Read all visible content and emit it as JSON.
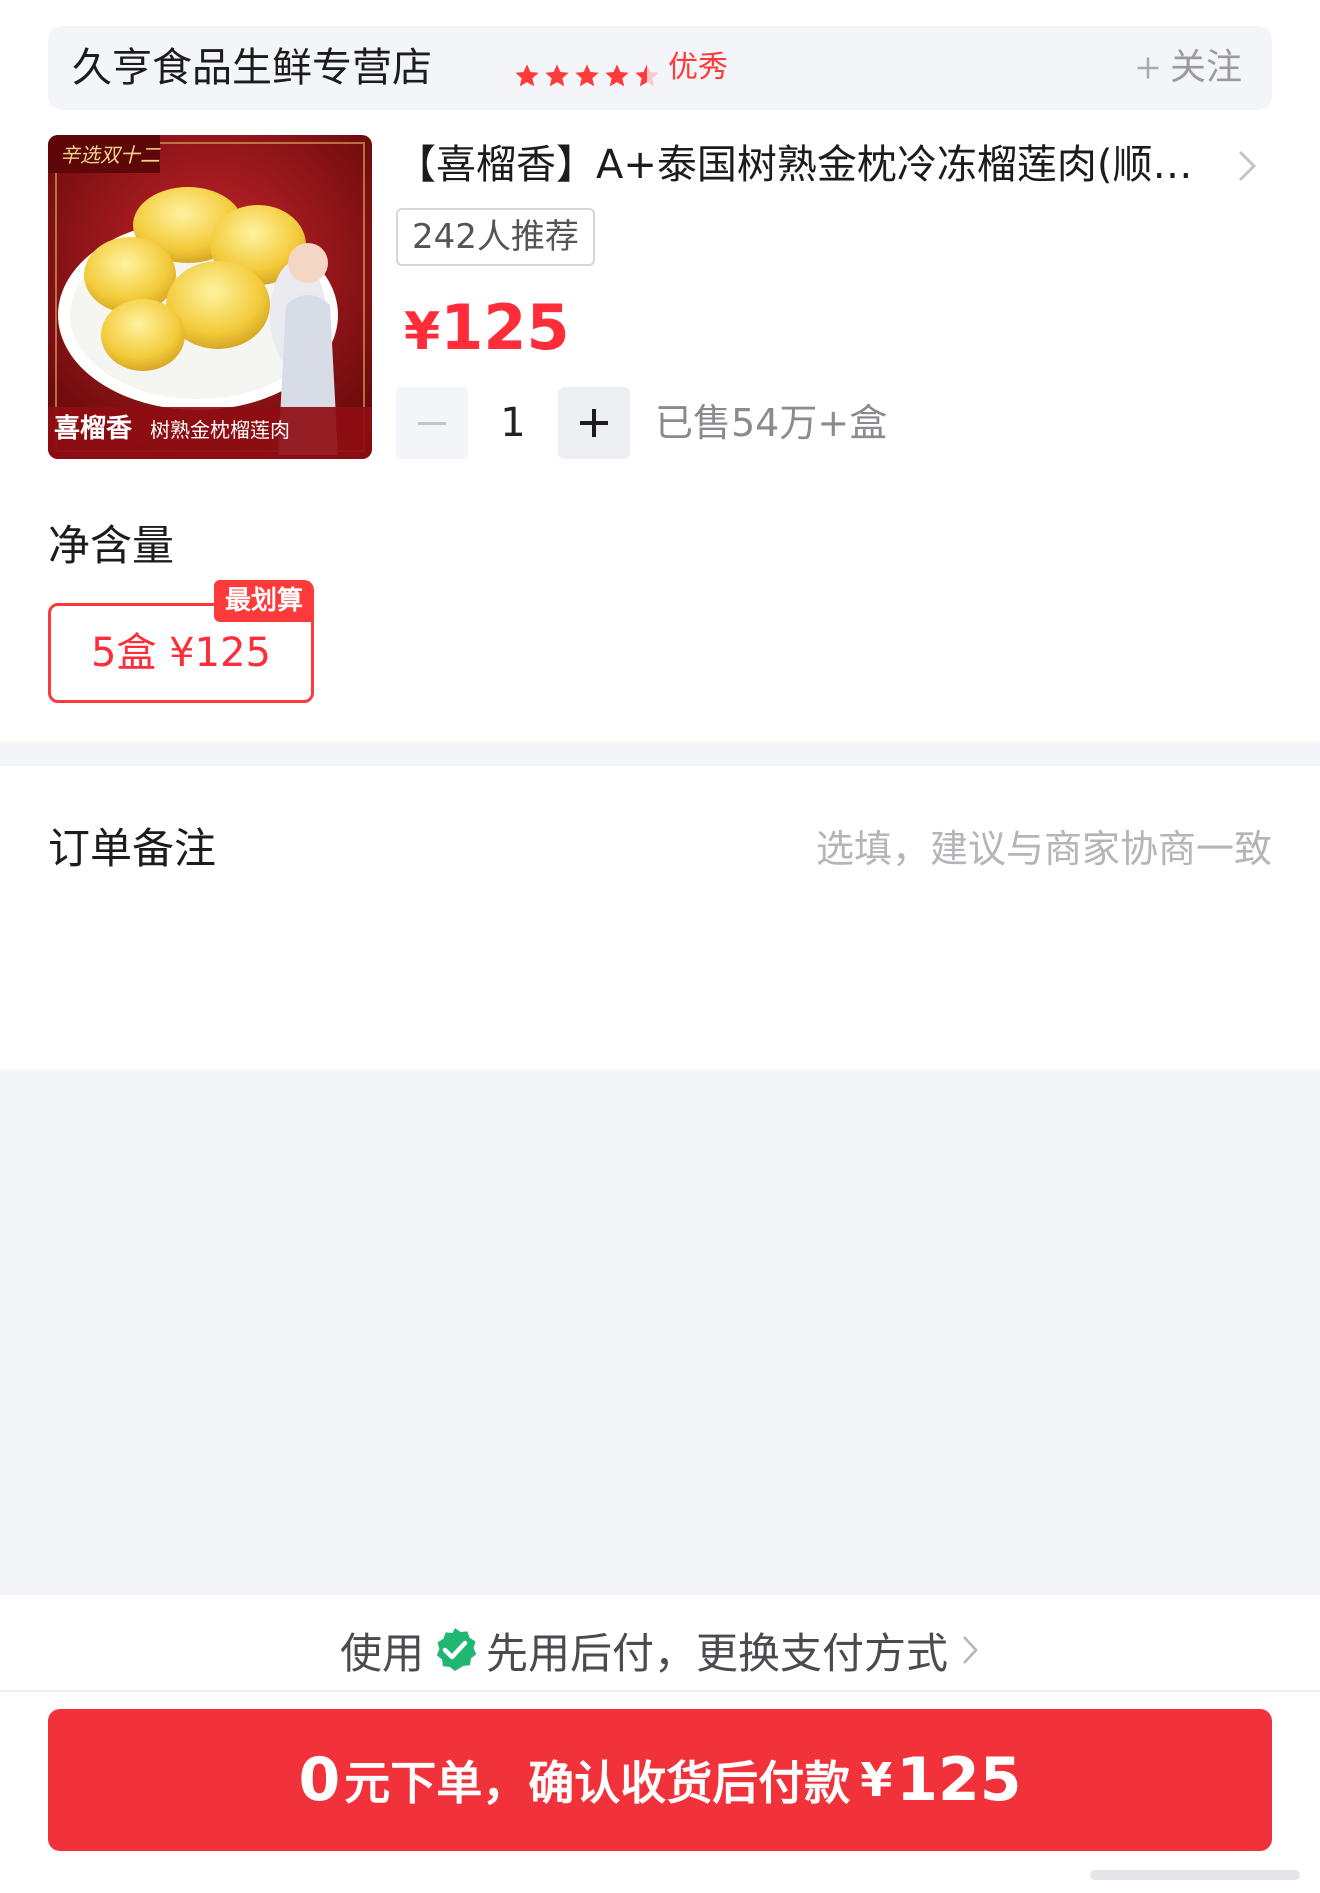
{
  "store": {
    "name": "久亨食品生鲜专营店",
    "rating_stars": 4.5,
    "rating_label": "优秀",
    "follow_label": "关注",
    "follow_icon": "plus-icon"
  },
  "product": {
    "image_banner": "辛选双十二",
    "image_brand": "喜榴香",
    "image_caption": "树熟金枕榴莲肉",
    "title": "【喜榴香】A+泰国树熟金枕冷冻榴莲肉(顺丰冷链)",
    "recommend_tag": "242人推荐",
    "price_symbol": "¥",
    "price_value": "125",
    "quantity": "1",
    "sold": "已售54万+盒"
  },
  "spec": {
    "title": "净含量",
    "option_label": "5盒 ¥125",
    "option_badge": "最划算"
  },
  "remark": {
    "label": "订单备注",
    "placeholder": "选填，建议与商家协商一致",
    "value": ""
  },
  "payment": {
    "prefix": "使用",
    "method": "先用后付，更换支付方式",
    "icon": "verified-check-icon"
  },
  "order_button": {
    "zero": "0",
    "text": "元下单，确认收货后付款",
    "yen": "¥",
    "amount": "125"
  },
  "colors": {
    "accent": "#ff2d39",
    "button": "#f2323a",
    "verified_green": "#21b672",
    "background_gray": "#f4f5f8"
  }
}
